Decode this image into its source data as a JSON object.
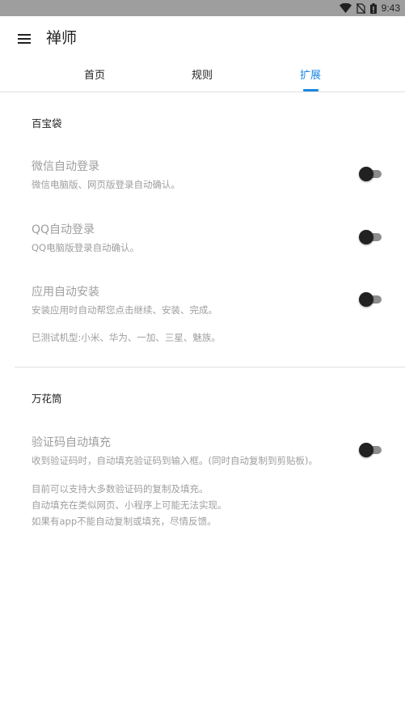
{
  "status_bar": {
    "time": "9:43"
  },
  "app_bar": {
    "title": "禅师"
  },
  "tabs": [
    {
      "label": "首页",
      "active": false
    },
    {
      "label": "规则",
      "active": false
    },
    {
      "label": "扩展",
      "active": true
    }
  ],
  "sections": [
    {
      "title": "百宝袋",
      "items": [
        {
          "title": "微信自动登录",
          "desc": "微信电脑版、网页版登录自动确认。",
          "enabled": false
        },
        {
          "title": "QQ自动登录",
          "desc": "QQ电脑版登录自动确认。",
          "enabled": false
        },
        {
          "title": "应用自动安装",
          "desc": "安装应用时自动帮您点击继续、安装、完成。",
          "enabled": false
        }
      ],
      "note": [
        "已测试机型:小米、华为、一加、三星、魅族。"
      ]
    },
    {
      "title": "万花筒",
      "items": [
        {
          "title": "验证码自动填充",
          "desc": "收到验证码时，自动填充验证码到输入框。(同时自动复制到剪贴板)。",
          "enabled": false
        }
      ],
      "note": [
        "目前可以支持大多数验证码的复制及填充。",
        "自动填充在类似网页、小程序上可能无法实现。",
        "如果有app不能自动复制或填充，尽情反馈。"
      ]
    }
  ],
  "colors": {
    "accent": "#1e88e5",
    "status_bar": "#9e9e9e",
    "secondary_text": "#9e9e9e"
  }
}
